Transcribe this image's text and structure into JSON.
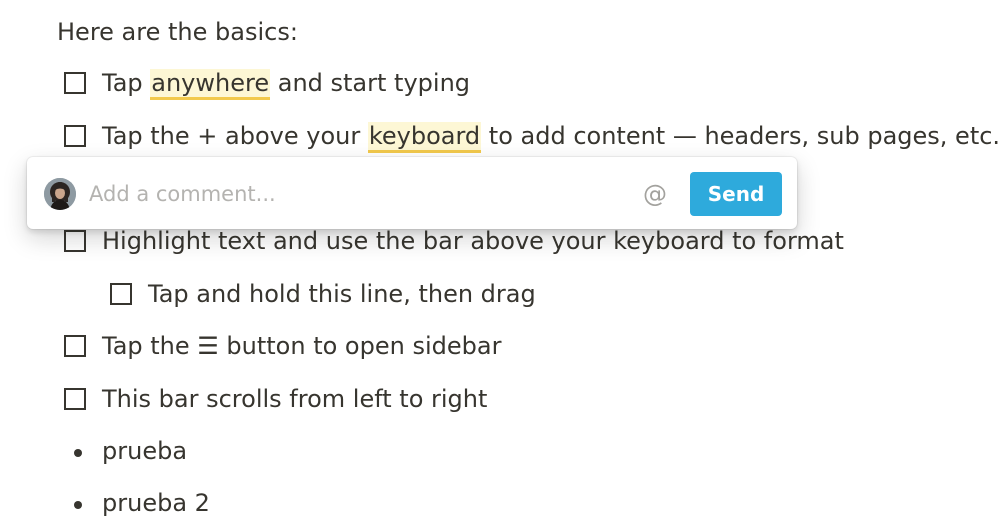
{
  "intro": "Here are the basics:",
  "items": [
    {
      "type": "todo",
      "parts": [
        "Tap ",
        "anywhere",
        " and start typing"
      ],
      "highlight_index": 1
    },
    {
      "type": "todo",
      "parts": [
        "Tap the + above your ",
        "keyboard",
        " to add content — headers, sub pages, etc."
      ],
      "highlight_index": 1
    },
    {
      "type": "todo",
      "text": "Highlight text and use the bar above your keyboard to format"
    },
    {
      "type": "todo",
      "text": "Tap and hold this line, then drag",
      "indent": 1
    },
    {
      "type": "todo",
      "text": "Tap the ☰ button to open sidebar"
    },
    {
      "type": "todo",
      "text": "This bar scrolls from left to right"
    },
    {
      "type": "bullet",
      "text": "prueba"
    },
    {
      "type": "bullet",
      "text": "prueba 2"
    }
  ],
  "comment": {
    "placeholder": "Add a comment...",
    "at_symbol": "@",
    "send_label": "Send",
    "send_color": "#2eaadc",
    "avatar_icon": "user-avatar"
  },
  "colors": {
    "text": "#37352f",
    "highlight_bg": "#fdf7d5",
    "highlight_underline": "#f2c94c"
  }
}
